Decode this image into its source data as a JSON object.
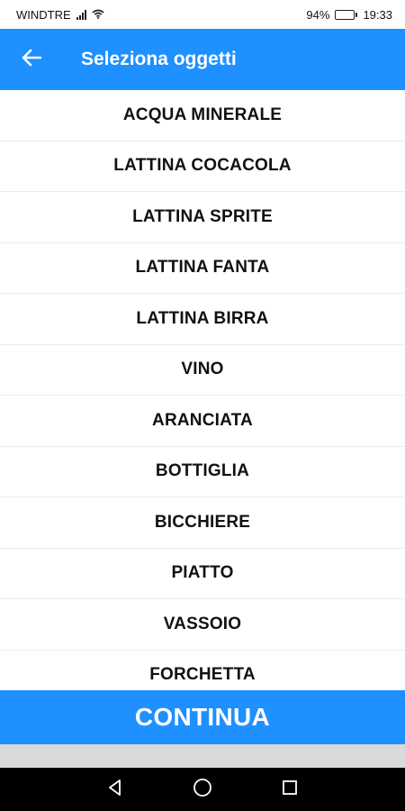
{
  "status_bar": {
    "carrier": "WINDTRE",
    "battery_percent": "94%",
    "battery_level": 0.94,
    "time": "19:33"
  },
  "app_bar": {
    "title": "Seleziona oggetti",
    "back_icon": "arrow-left-icon"
  },
  "items": [
    "ACQUA MINERALE",
    "LATTINA COCACOLA",
    "LATTINA SPRITE",
    "LATTINA FANTA",
    "LATTINA BIRRA",
    "VINO",
    "ARANCIATA",
    "BOTTIGLIA",
    "BICCHIERE",
    "PIATTO",
    "VASSOIO",
    "FORCHETTA"
  ],
  "continue_button": {
    "label": "CONTINUA"
  },
  "colors": {
    "accent": "#1e90ff",
    "nav_bar": "#000000"
  },
  "nav_bar": {
    "buttons": [
      "back-triangle-icon",
      "home-circle-icon",
      "recents-square-icon"
    ]
  }
}
